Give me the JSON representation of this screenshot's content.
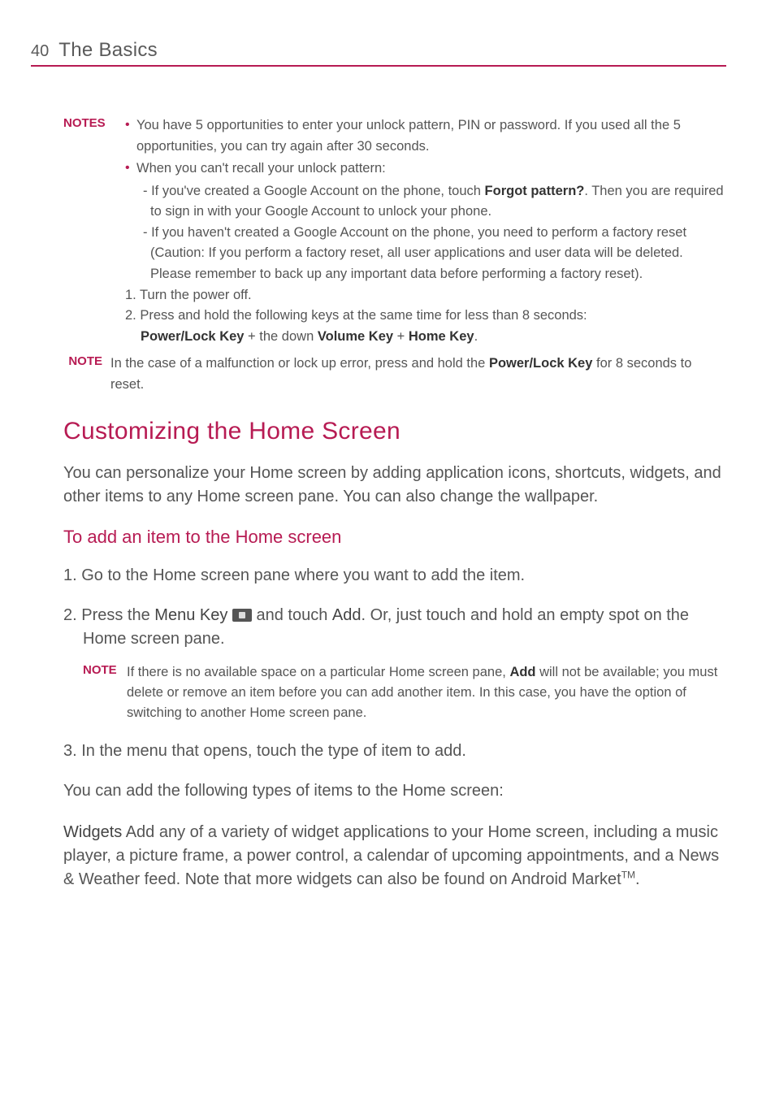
{
  "header": {
    "page_number": "40",
    "title": "The Basics"
  },
  "notes_label": "NOTES",
  "note_label": "NOTE",
  "notes1": {
    "b1": "You have 5 opportunities to enter your unlock pattern, PIN or password. If you used all the 5 opportunities, you can try again after 30 seconds.",
    "b2": "When you can't recall your unlock pattern:",
    "d1a": "- If you've created a Google Account on the phone, touch ",
    "d1b": "Forgot pattern?",
    "d1c": ". Then you are required to sign in with your Google Account to unlock your phone.",
    "d2": "- If you haven't created a Google Account on the phone, you need to perform a factory reset (Caution: If you perform a factory reset, all user applications and user data will be deleted. Please remember to back up any important data before performing a factory reset).",
    "n1": "1. Turn the power off.",
    "n2a": "2. Press and hold the following keys at the same time for less than 8 seconds: ",
    "n2b": "Power/Lock Key",
    "n2c": " + the down ",
    "n2d": "Volume Key",
    "n2e": " + ",
    "n2f": "Home Key",
    "n2g": "."
  },
  "note2a": "In the case of a malfunction or lock up error, press and hold the ",
  "note2b": "Power/Lock Key",
  "note2c": " for 8 seconds to reset.",
  "h1": "Customizing the Home Screen",
  "intro": "You can personalize your Home screen by adding application icons, shortcuts, widgets, and other items to any Home screen pane. You can also change the wallpaper.",
  "h2": "To add an item to the Home screen",
  "step1": "1. Go to the Home screen pane where you want to add the item.",
  "step2a": "2. Press the ",
  "step2b": "Menu Key",
  "step2c": " and touch ",
  "step2d": "Add",
  "step2e": ". Or, just touch and hold an empty spot on the Home screen pane.",
  "note3a": "If there is no available space on a particular Home screen pane, ",
  "note3b": "Add",
  "note3c": " will not be available; you must delete or remove an item before you can add another item. In this case, you have the option of switching to another Home screen pane.",
  "step3": "3. In the menu that opens, touch the type of item to add.",
  "para4": "You can add the following types of items to the Home screen:",
  "widgets_label": "Widgets",
  "widgets_body_a": "  Add any of a variety of widget applications to your Home screen, including a music player, a picture frame, a power control, a calendar of upcoming appointments, and a News & Weather feed. Note that more widgets can also be found on Android Market",
  "widgets_body_b": "TM",
  "widgets_body_c": "."
}
